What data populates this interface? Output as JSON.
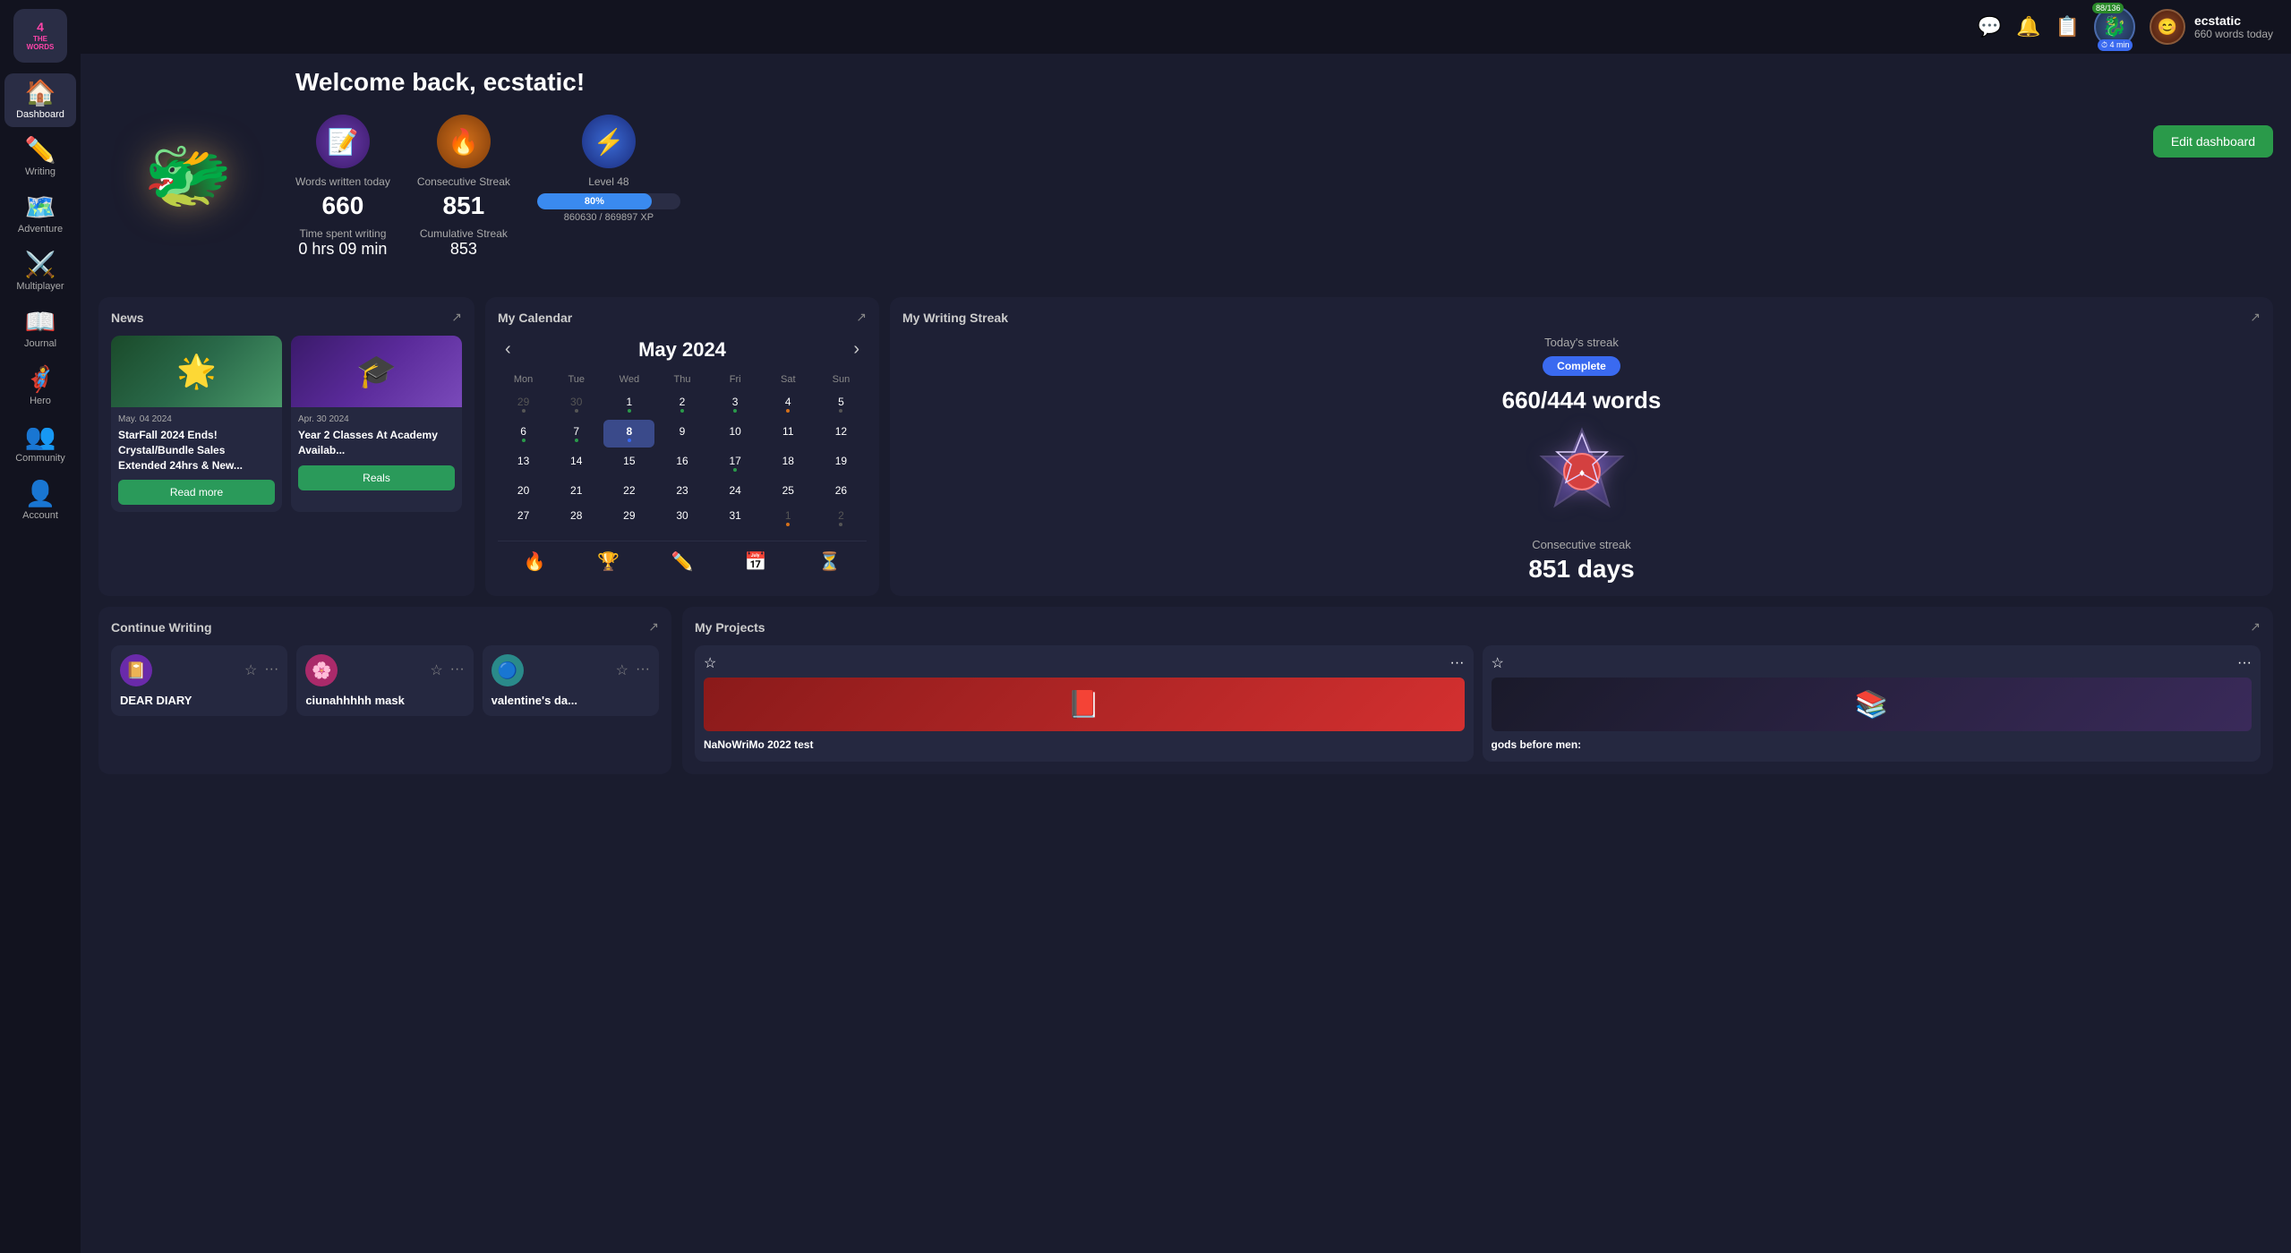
{
  "sidebar": {
    "logo": {
      "line1": "4THE",
      "line2": "WORDS"
    },
    "items": [
      {
        "id": "dashboard",
        "label": "Dashboard",
        "icon": "🏠",
        "active": true
      },
      {
        "id": "writing",
        "label": "Writing",
        "icon": "✏️",
        "active": false
      },
      {
        "id": "adventure",
        "label": "Adventure",
        "icon": "🗺️",
        "active": false
      },
      {
        "id": "multiplayer",
        "label": "Multiplayer",
        "icon": "⚔️",
        "active": false
      },
      {
        "id": "journal",
        "label": "Journal",
        "icon": "📖",
        "active": false
      },
      {
        "id": "hero",
        "label": "Hero",
        "icon": "🦸",
        "active": false
      },
      {
        "id": "community",
        "label": "Community",
        "icon": "👥",
        "active": false
      },
      {
        "id": "account",
        "label": "Account",
        "icon": "👤",
        "active": false
      }
    ]
  },
  "topbar": {
    "chat_icon": "💬",
    "bell_icon": "🔔",
    "notebook_icon": "📋",
    "character_badge": "88/136",
    "character_time": "⏱ 4 min",
    "username": "ecstatic",
    "words_today": "660 words today"
  },
  "welcome": {
    "title": "Welcome back, ecstatic!",
    "character_emoji": "🐉",
    "edit_button": "Edit dashboard"
  },
  "stats": {
    "words_today_label": "Words written today",
    "words_today_value": "660",
    "time_label": "Time spent writing",
    "time_value": "0 hrs 09 min",
    "streak_label": "Consecutive Streak",
    "streak_value": "851",
    "cumulative_label": "Cumulative Streak",
    "cumulative_value": "853",
    "level_label": "Level 48",
    "level_percent": "80%",
    "level_percent_num": 80,
    "level_xp": "860630 / 869897 XP"
  },
  "news": {
    "title": "News",
    "cards": [
      {
        "date": "May. 04 2024",
        "title": "StarFall 2024 Ends! Crystal/Bundle Sales Extended 24hrs & New...",
        "button": "Read more",
        "color": "green",
        "emoji": "🌟"
      },
      {
        "date": "Apr. 30 2024",
        "title": "Year 2 Classes At Academy Availab...",
        "button": "Reals",
        "color": "purple",
        "emoji": "🎓"
      }
    ]
  },
  "calendar": {
    "title": "My Calendar",
    "month": "May 2024",
    "headers": [
      "Mon",
      "Tue",
      "Wed",
      "Thu",
      "Fri",
      "Sat",
      "Sun"
    ],
    "rows": [
      [
        "29",
        "30",
        "1",
        "2",
        "3",
        "4",
        "5"
      ],
      [
        "6",
        "7",
        "8",
        "9",
        "10",
        "11",
        "12"
      ],
      [
        "13",
        "14",
        "15",
        "16",
        "17",
        "18",
        "19"
      ],
      [
        "20",
        "21",
        "22",
        "23",
        "24",
        "25",
        "26"
      ],
      [
        "27",
        "28",
        "29",
        "30",
        "31",
        "1",
        "2"
      ]
    ],
    "today": "8",
    "icons": [
      "🔥",
      "🏆",
      "✏️",
      "📅",
      "⏳"
    ]
  },
  "writing_streak": {
    "title": "My Writing Streak",
    "today_label": "Today's streak",
    "complete_badge": "Complete",
    "words": "660/444 words",
    "streak_label": "Consecutive streak",
    "streak_days": "851 days",
    "emblem": "🛡️"
  },
  "continue_writing": {
    "title": "Continue Writing",
    "cards": [
      {
        "icon": "📔",
        "color": "purple",
        "title": "DEAR DIARY"
      },
      {
        "icon": "🌸",
        "color": "pink",
        "title": "ciunahhhhh mask"
      },
      {
        "icon": "🔵",
        "color": "teal",
        "title": "valentine's da..."
      }
    ]
  },
  "my_projects": {
    "title": "My Projects",
    "cards": [
      {
        "color": "red",
        "emoji": "📕",
        "title": "NaNoWriMo 2022 test"
      },
      {
        "color": "dark",
        "emoji": "📚",
        "title": "gods before men:"
      }
    ]
  }
}
